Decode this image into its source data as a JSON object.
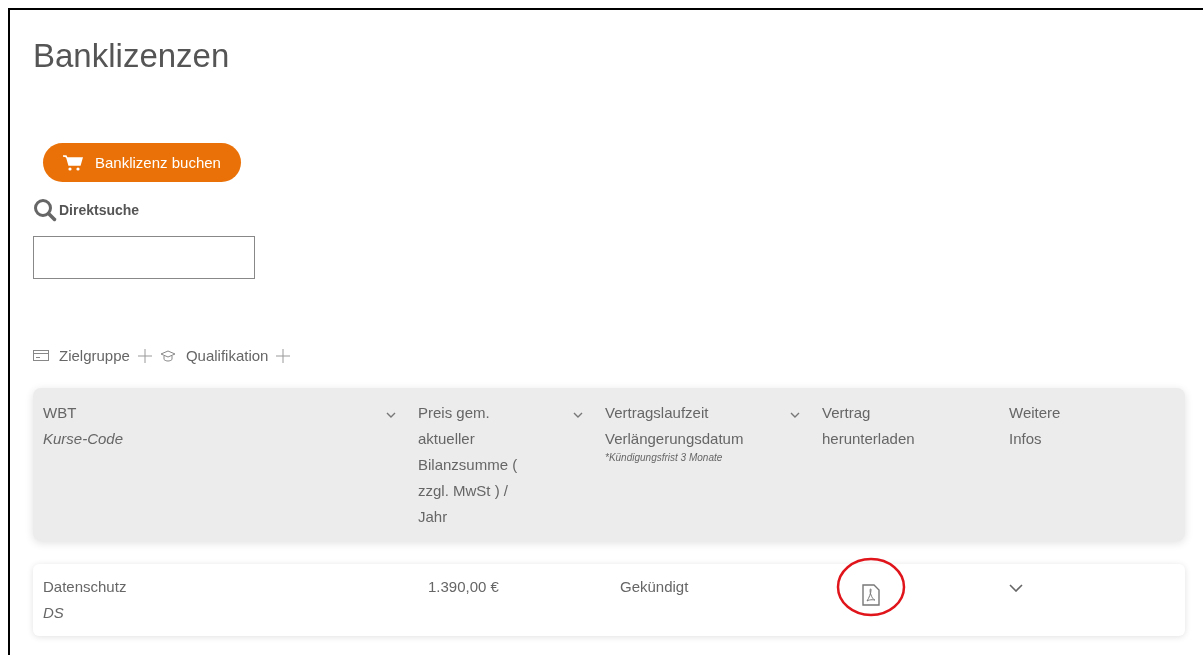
{
  "page": {
    "title": "Banklizenzen"
  },
  "book_button": {
    "label": "Banklizenz buchen"
  },
  "search": {
    "label": "Direktsuche"
  },
  "filters": [
    {
      "label": "Zielgruppe",
      "kind": "card"
    },
    {
      "label": "Qualifikation",
      "kind": "cap"
    }
  ],
  "table": {
    "columns": [
      {
        "title": "WBT",
        "subtitle": "Kurse-Code",
        "sortable": true
      },
      {
        "title": "Preis gem. aktueller Bilanzsumme ( zzgl. MwSt ) / Jahr",
        "sortable": true
      },
      {
        "title": "Vertragslaufzeit",
        "title_2": "Verlängerungsdatum",
        "note": "*Kündigungsfrist 3 Monate",
        "sortable": true
      },
      {
        "title": "Vertrag herunterladen",
        "sortable": false
      },
      {
        "title": "Weitere Infos",
        "sortable": false
      }
    ],
    "rows": [
      {
        "name": "Datenschutz",
        "code": "DS",
        "price": "1.390,00 €",
        "status": "Gekündigt",
        "has_pdf": true,
        "highlighted": true,
        "expanded": false
      }
    ]
  }
}
